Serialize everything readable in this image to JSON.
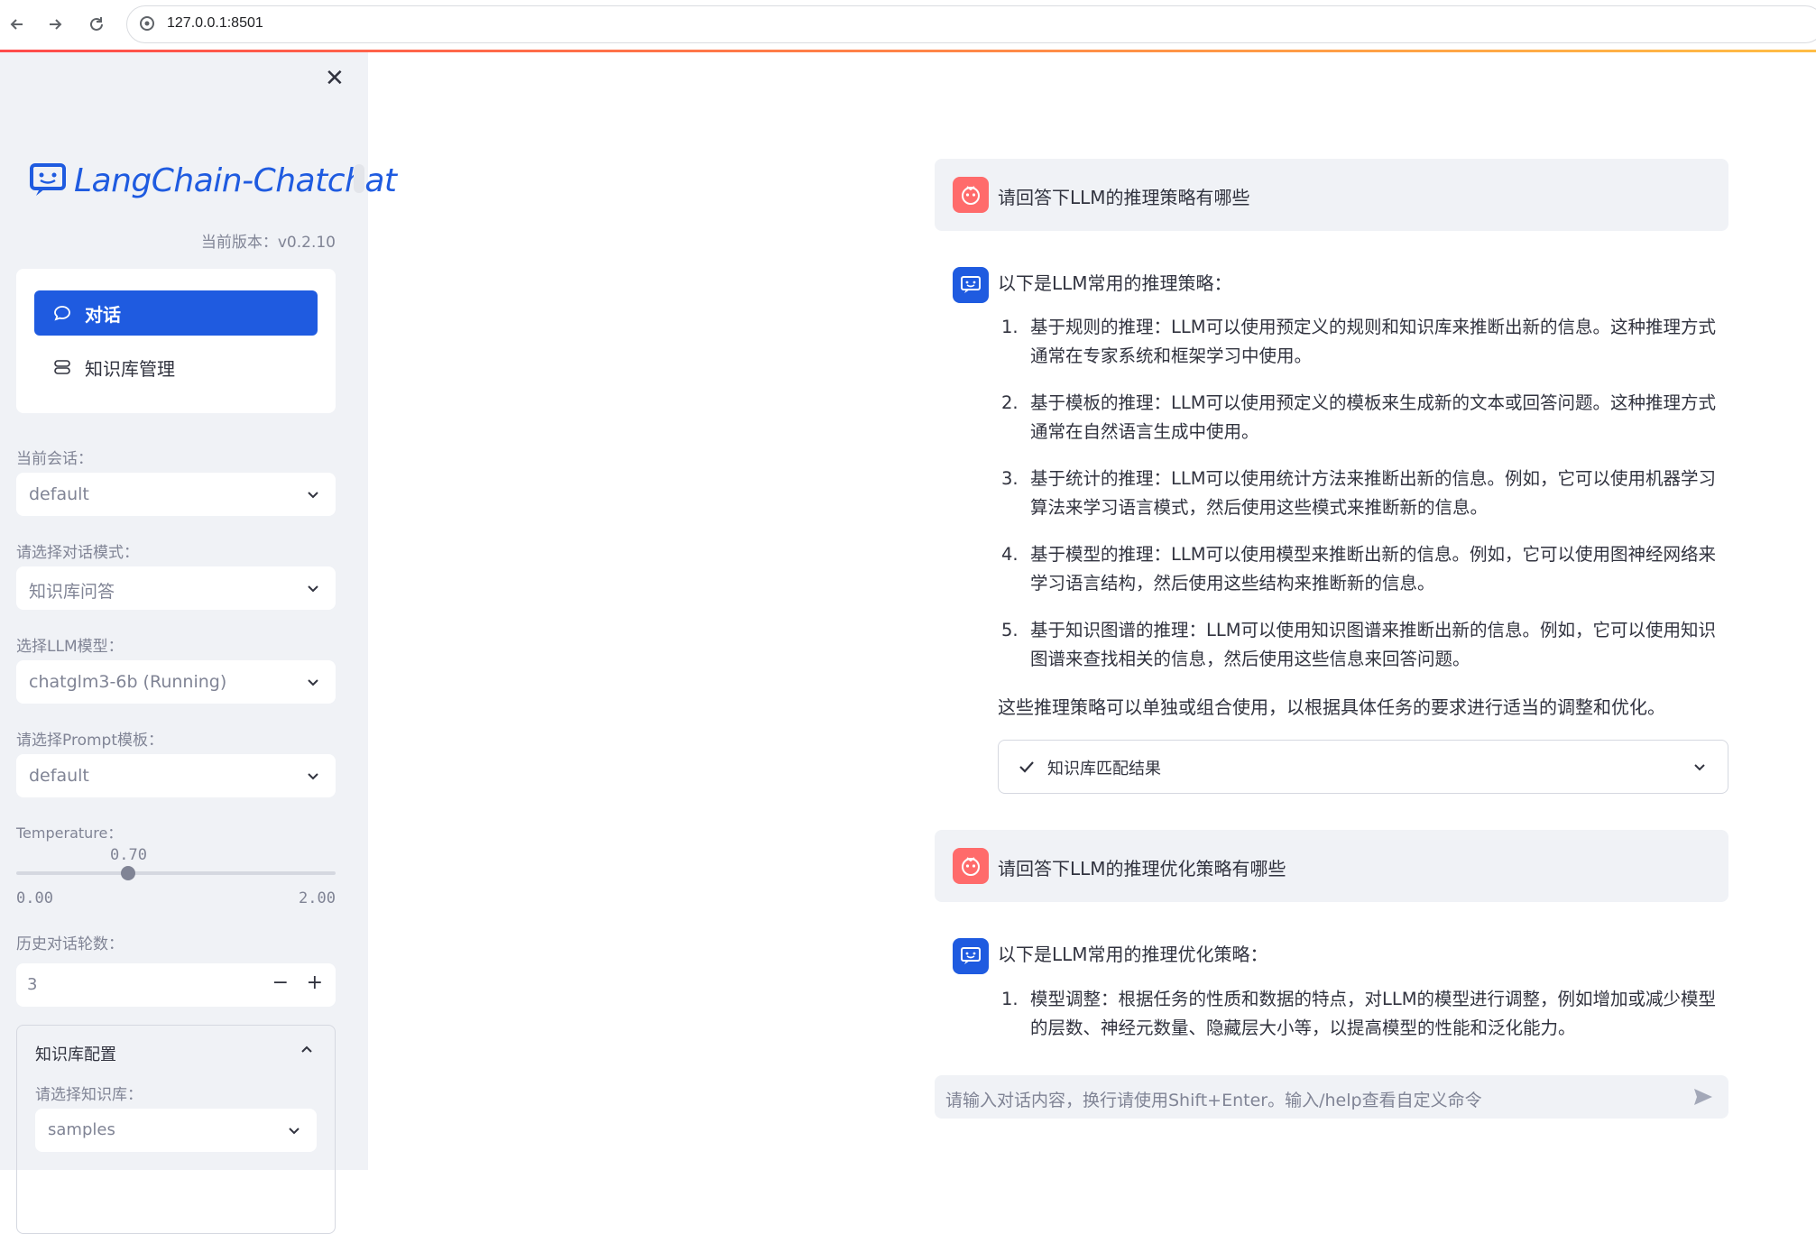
{
  "browser": {
    "url": "127.0.0.1:8501",
    "back_icon": "arrow-left-icon",
    "forward_icon": "arrow-right-icon",
    "reload_icon": "reload-icon"
  },
  "sidebar": {
    "logo_text": "LangChain-Chatchat",
    "version": "当前版本：v0.2.10",
    "menu": [
      {
        "label": "对话",
        "icon": "chat-bubble-icon",
        "active": true
      },
      {
        "label": "知识库管理",
        "icon": "database-icon",
        "active": false
      }
    ],
    "session_label": "当前会话：",
    "session_value": "default",
    "mode_label": "请选择对话模式：",
    "mode_value": "知识库问答",
    "llm_label": "选择LLM模型：",
    "llm_value": "chatglm3-6b (Running)",
    "prompt_label": "请选择Prompt模板：",
    "prompt_value": "default",
    "temperature_label": "Temperature：",
    "temperature_value": "0.70",
    "temperature_min": "0.00",
    "temperature_max": "2.00",
    "temperature_fraction": 0.35,
    "history_label": "历史对话轮数：",
    "history_value": "3",
    "stepper_minus": "−",
    "stepper_plus": "+",
    "kb_config_title": "知识库配置",
    "kb_select_label": "请选择知识库：",
    "kb_select_value": "samples"
  },
  "chat": {
    "messages": [
      {
        "role": "user",
        "text": "请回答下LLM的推理策略有哪些"
      },
      {
        "role": "assistant",
        "intro": "以下是LLM常用的推理策略：",
        "items": [
          {
            "num": "1.",
            "text": "基于规则的推理：LLM可以使用预定义的规则和知识库来推断出新的信息。这种推理方式通常在专家系统和框架学习中使用。"
          },
          {
            "num": "2.",
            "text": "基于模板的推理：LLM可以使用预定义的模板来生成新的文本或回答问题。这种推理方式通常在自然语言生成中使用。"
          },
          {
            "num": "3.",
            "text": "基于统计的推理：LLM可以使用统计方法来推断出新的信息。例如，它可以使用机器学习算法来学习语言模式，然后使用这些模式来推断新的信息。"
          },
          {
            "num": "4.",
            "text": "基于模型的推理：LLM可以使用模型来推断出新的信息。例如，它可以使用图神经网络来学习语言结构，然后使用这些结构来推断新的信息。"
          },
          {
            "num": "5.",
            "text": "基于知识图谱的推理：LLM可以使用知识图谱来推断出新的信息。例如，它可以使用知识图谱来查找相关的信息，然后使用这些信息来回答问题。"
          }
        ],
        "summary": "这些推理策略可以单独或组合使用，以根据具体任务的要求进行适当的调整和优化。",
        "kb_result_label": "知识库匹配结果"
      },
      {
        "role": "user",
        "text": "请回答下LLM的推理优化策略有哪些"
      },
      {
        "role": "assistant",
        "intro": "以下是LLM常用的推理优化策略：",
        "items": [
          {
            "num": "1.",
            "text": "模型调整：根据任务的性质和数据的特点，对LLM的模型进行调整，例如增加或减少模型的层数、神经元数量、隐藏层大小等，以提高模型的性能和泛化能力。"
          }
        ]
      }
    ],
    "input_placeholder": "请输入对话内容，换行请使用Shift+Enter。输入/help查看自定义命令",
    "send_icon": "send-icon"
  },
  "colors": {
    "accent": "#1f5be0",
    "sidebar_bg": "#f0f2f6",
    "user_avatar": "#ff6b6b",
    "muted_text": "#808495"
  }
}
